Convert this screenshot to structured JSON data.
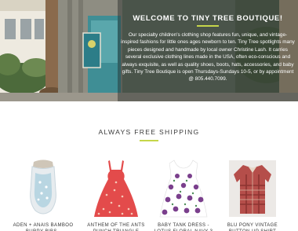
{
  "hero": {
    "title": "Welcome to Tiny Tree Boutique!",
    "body": "Our specialty children's clothing shop features fun, unique, and vintage-inspired fashions for little ones ages newborn to ten. Tiny Tree spotlights many pieces designed and handmade by local owner Christine Lash. It carries several exclusive clothing lines made in the USA, often eco-conscious and always exquisite, as well as quality shoes, boots, hats, accessories, and baby gifts. Tiny Tree Boutique is open Thursdays-Sundays 10-5, or by appointment @ 805.440.7099."
  },
  "shipping": {
    "title": "Always Free Shipping"
  },
  "products": [
    {
      "name": "ADEN + ANAIS BAMBOO BURPY BIBS - MOONLIGHT"
    },
    {
      "name": "ANTHEM OF THE ANTS PUNCH TRIANGLE PRINTED"
    },
    {
      "name": "BABY TANK DRESS - LOTUS FLORAL NAVY 3"
    },
    {
      "name": "BLU PONY VINTAGE BUTTON-UP SHIRT"
    }
  ],
  "colors": {
    "accent": "#c6d64a",
    "overlay": "#2d3230",
    "text": "#333333"
  }
}
